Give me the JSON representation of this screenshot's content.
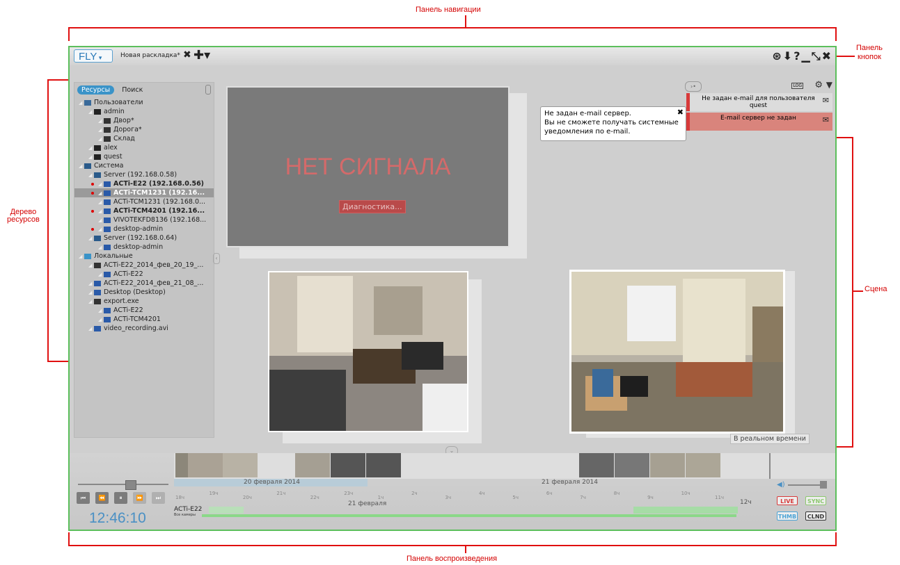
{
  "annotations": {
    "nav_panel": "Панель навигации",
    "buttons_panel_l1": "Панель",
    "buttons_panel_l2": "кнопок",
    "resource_tree_l1": "Дерево",
    "resource_tree_l2": "ресурсов",
    "scene": "Сцена",
    "playback_panel": "Панель воспроизведения"
  },
  "topbar": {
    "logo": "FLY",
    "tab_name": "Новая раскладка*",
    "close_tab": "✖",
    "new_tab": "✚▾",
    "window_buttons": "⊛⬇?▁⤡✖"
  },
  "tree": {
    "tab_resources": "Ресурсы",
    "tab_search": "Поиск",
    "items": [
      {
        "label": "Пользователи",
        "indent": 0,
        "icon": "users-icon"
      },
      {
        "label": "admin",
        "indent": 1,
        "icon": "user-icon"
      },
      {
        "label": "Двор*",
        "indent": 2,
        "icon": "layout-icon"
      },
      {
        "label": "Дорога*",
        "indent": 2,
        "icon": "layout-icon"
      },
      {
        "label": "Склад",
        "indent": 2,
        "icon": "layout-icon"
      },
      {
        "label": "alex",
        "indent": 1,
        "icon": "user-icon"
      },
      {
        "label": "quest",
        "indent": 1,
        "icon": "user-icon"
      },
      {
        "label": "Система",
        "indent": 0,
        "icon": "server-icon"
      },
      {
        "label": "Server (192.168.0.58)",
        "indent": 1,
        "icon": "server-icon"
      },
      {
        "label": "ACTi-E22 (192.168.0.56)",
        "indent": 2,
        "icon": "camera-icon",
        "bold": true,
        "rec": true
      },
      {
        "label": "ACTi-TCM1231 (192.16...",
        "indent": 2,
        "icon": "camera-icon",
        "bold": true,
        "rec": true,
        "selected": true
      },
      {
        "label": "ACTi-TCM1231 (192.168.0...",
        "indent": 2,
        "icon": "camera-icon"
      },
      {
        "label": "ACTi-TCM4201 (192.16...",
        "indent": 2,
        "icon": "camera-icon",
        "bold": true,
        "rec": true
      },
      {
        "label": "VIVOTEKFD8136 (192.168...",
        "indent": 2,
        "icon": "camera-icon"
      },
      {
        "label": "desktop-admin",
        "indent": 2,
        "icon": "camera-icon",
        "rec": true
      },
      {
        "label": "Server (192.168.0.64)",
        "indent": 1,
        "icon": "server-icon"
      },
      {
        "label": "desktop-admin",
        "indent": 2,
        "icon": "camera-icon"
      },
      {
        "label": "Локальные",
        "indent": 0,
        "icon": "home-icon"
      },
      {
        "label": "ACTi-E22_2014_фев_20_19_...",
        "indent": 1,
        "icon": "folder-icon"
      },
      {
        "label": "ACTi-E22",
        "indent": 2,
        "icon": "file-icon"
      },
      {
        "label": "ACTi-E22_2014_фев_21_08_...",
        "indent": 1,
        "icon": "file-icon"
      },
      {
        "label": "Desktop (Desktop)",
        "indent": 1,
        "icon": "camera-icon"
      },
      {
        "label": "export.exe",
        "indent": 1,
        "icon": "folder-icon"
      },
      {
        "label": "ACTi-E22",
        "indent": 2,
        "icon": "file-icon"
      },
      {
        "label": "ACTi-TCM4201",
        "indent": 2,
        "icon": "file-icon"
      },
      {
        "label": "video_recording.avi",
        "indent": 1,
        "icon": "file-icon"
      }
    ]
  },
  "scene": {
    "no_signal": "НЕТ СИГНАЛА",
    "diagnostics": "Диагностика...",
    "realtime_badge": "В реальном времени"
  },
  "notifications": {
    "log": "LOG",
    "items": [
      {
        "text": "Не задан e-mail для пользователя quest",
        "highlight": false
      },
      {
        "text": "E-mail сервер не задан",
        "highlight": true
      }
    ],
    "tooltip_lines": [
      "Не задан e-mail сервер.",
      "Вы не сможете получать системные",
      "уведомления по e-mail."
    ],
    "tooltip_close": "✖"
  },
  "playback": {
    "time": "12:46:10",
    "date1": "20 февраля 2014",
    "date2": "21 февраля 2014",
    "day_label": "21 февраля",
    "end_label": "12ч",
    "camera": "ACTi-E22",
    "camera_sub": "Все камеры",
    "controls": [
      "⏮",
      "⏪",
      "⏸",
      "⏩",
      "⏭"
    ],
    "ticks": [
      "18ч",
      "19ч",
      "20ч",
      "21ч",
      "22ч",
      "23ч",
      "1ч",
      "2ч",
      "3ч",
      "4ч",
      "5ч",
      "6ч",
      "7ч",
      "8ч",
      "9ч",
      "10ч",
      "11ч"
    ],
    "live": "LIVE",
    "sync": "SYNC",
    "thmb": "THMB",
    "clnd": "CLND",
    "colors": {
      "live": "#d83a3a",
      "sync": "#8cc86e",
      "thmb": "#4aa3d6",
      "clnd": "#333333",
      "time": "#4a90c4",
      "accent": "#3a93c8"
    }
  }
}
